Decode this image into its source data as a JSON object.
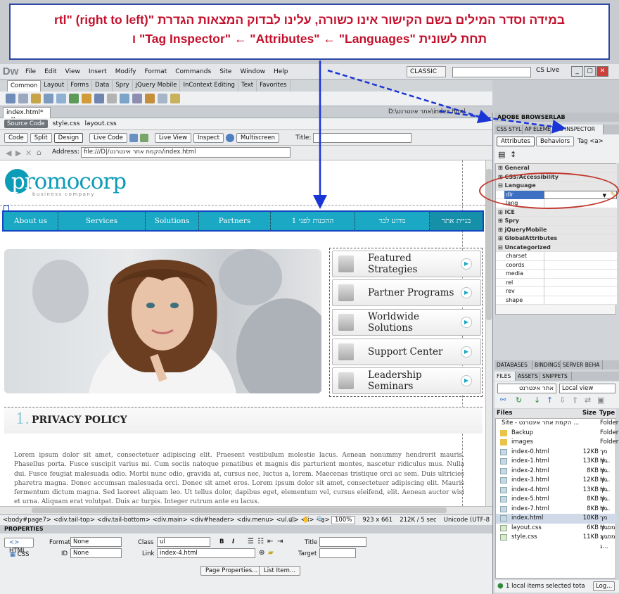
{
  "callout": {
    "line1": "במידה וסדר המילים בשם הקישור אינו כשורה, עלינו לבדוק המצאות הגדרת \"rtl\" (right to left)",
    "line2": "תחת לשונית \"Tag Inspector\" ← \"Attributes\" ← \"Languages\" ו"
  },
  "app": {
    "logo": "Dw",
    "layout_mode": "CLASSIC",
    "cs_live": "CS Live"
  },
  "menu": [
    "File",
    "Edit",
    "View",
    "Insert",
    "Modify",
    "Format",
    "Commands",
    "Site",
    "Window",
    "Help"
  ],
  "insert_tabs": [
    "Common",
    "Layout",
    "Forms",
    "Data",
    "Spry",
    "jQuery Mobile",
    "InContext Editing",
    "Text",
    "Favorites"
  ],
  "document": {
    "tab": "index.html*",
    "path": "D:\\אתר אינטרנט\\index.html",
    "related_files": [
      "Source Code",
      "style.css",
      "layout.css"
    ],
    "view_buttons": [
      "Code",
      "Split",
      "Design",
      "Live Code",
      "Live View",
      "Inspect",
      "Multiscreen"
    ],
    "title_label": "Title:",
    "address_label": "Address:",
    "address_value": "file:///D|/הקמת אתר אינטרנט/index.html"
  },
  "page": {
    "logo_main": "promocorp",
    "logo_sub": "business company",
    "nav": [
      "About us",
      "Services",
      "Solutions",
      "Partners",
      "ההכנות לפני 1",
      "מדוע לבד",
      "בניית אתר"
    ],
    "side_items": [
      "Featured Strategies",
      "Partner Programs",
      "Worldwide Solutions",
      "Support Center",
      "Leadership Seminars"
    ],
    "section_num": "1.",
    "section_title": "PRIVACY POLICY",
    "lorem": "Lorem ipsum dolor sit amet, consectetuer adipiscing elit. Praesent vestibulum molestie lacus. Aenean nonummy hendrerit mauris. Phasellus porta. Fusce suscipit varius mi. Cum sociis natoque penatibus et magnis dis parturient montes, nascetur ridiculus mus. Nulla dui. Fusce feugiat malesuada odio. Morbi nunc odio, gravida at, cursus nec, luctus a, lorem. Maecenas tristique orci ac sem. Duis ultricies pharetra magna. Donec accumsan malesuada orci. Donec sit amet eros. Lorem ipsum dolor sit amet, consectetuer adipiscing elit. Mauris fermentum dictum magna. Sed laoreet aliquam leo. Ut tellus dolor, dapibus eget, elementum vel, cursus eleifend, elit. Aenean auctor wisi et urna. Aliquam erat volutpat. Duis ac turpis. Integer rutrum ante eu lacus."
  },
  "status": {
    "tag_path": "<body#page7> <div.tail-top> <div.tail-bottom> <div.main> <div#header> <div.menu> <ul.ul> <li> <a>",
    "zoom": "100%",
    "size": "923 x 661",
    "weight": "212K / 5 sec",
    "encoding": "Unicode (UTF-8"
  },
  "properties": {
    "title": "PROPERTIES",
    "html": "HTML",
    "css": "CSS",
    "format_label": "Format",
    "format_value": "None",
    "class_label": "Class",
    "class_value": "ul",
    "title_label": "Title",
    "id_label": "ID",
    "id_value": "None",
    "link_label": "Link",
    "link_value": "index-4.html",
    "target_label": "Target",
    "page_props": "Page Properties...",
    "list_item": "List Item..."
  },
  "panels": {
    "browserlab": "ADOBE BROWSERLAB",
    "tabs": [
      "CSS STYL",
      "AP ELEME",
      "TAG INSPECTOR"
    ],
    "attr_tabs": [
      "Attributes",
      "Behaviors"
    ],
    "tag": "Tag <a>",
    "categories_top": [
      "General",
      "CSS/Accessibility",
      "Language"
    ],
    "lang_attrs": [
      "dir",
      "lang"
    ],
    "categories_mid": [
      "ICE",
      "Spry",
      "jQueryMobile",
      "GlobalAttributes",
      "Uncategorized"
    ],
    "uncat_attrs": [
      "charset",
      "coords",
      "media",
      "rel",
      "rev",
      "shape"
    ],
    "db_tabs": [
      "DATABASES",
      "BINDINGS",
      "SERVER BEHA"
    ],
    "files_tabs": [
      "FILES",
      "ASSETS",
      "SNIPPETS"
    ],
    "site_select": "אתר אינטרנט",
    "view_select": "Local view",
    "files_headers": [
      "Files",
      "Size",
      "Type"
    ],
    "files": [
      {
        "name": "Site - הקמת אתר אינטרנט ...",
        "size": "",
        "type": "Folder"
      },
      {
        "name": "Backup",
        "size": "",
        "type": "Folder"
      },
      {
        "name": "images",
        "size": "",
        "type": "Folder"
      },
      {
        "name": "index-0.html",
        "size": "12KB",
        "type": "מך H..."
      },
      {
        "name": "index-1.html",
        "size": "13KB",
        "type": "מך H..."
      },
      {
        "name": "index-2.html",
        "size": "8KB",
        "type": "מך H..."
      },
      {
        "name": "index-3.html",
        "size": "12KB",
        "type": "מך H..."
      },
      {
        "name": "index-4.html",
        "size": "13KB",
        "type": "מך H..."
      },
      {
        "name": "index-5.html",
        "size": "8KB",
        "type": "מך H..."
      },
      {
        "name": "index-7.html",
        "size": "8KB",
        "type": "מך H..."
      },
      {
        "name": "index.html",
        "size": "10KB",
        "type": "מך H..."
      },
      {
        "name": "layout.css",
        "size": "6KB",
        "type": "מסמך ג..."
      },
      {
        "name": "style.css",
        "size": "11KB",
        "type": "מסמך ג..."
      }
    ],
    "files_status": "1 local items selected tota",
    "log_btn": "Log..."
  },
  "colors": {
    "accent": "#1aa8c4",
    "callout_text": "#c3102c",
    "callout_border": "#2e49a3",
    "oval": "#c23a2f"
  }
}
